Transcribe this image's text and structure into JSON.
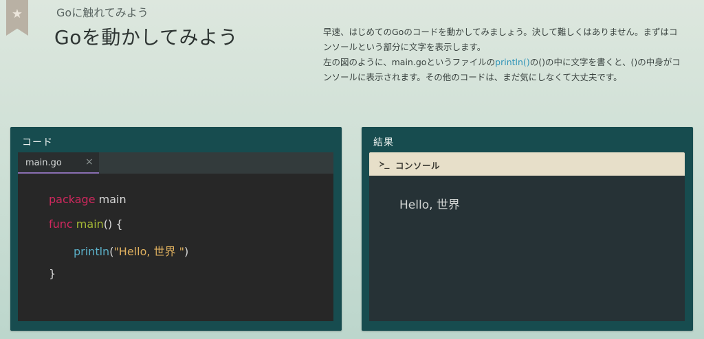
{
  "header": {
    "bookmark_icon": "star-icon",
    "subtitle": "Goに触れてみよう",
    "title": "Goを動かしてみよう"
  },
  "description": {
    "paragraph1": "早速、はじめてのGoのコードを動かしてみましょう。決して難しくはありません。まずはコンソールという部分に文字を表示します。",
    "p2_before": "左の図のように、main.goというファイルの",
    "p2_code": "println()",
    "p2_after": "の()の中に文字を書くと、()の中身がコンソールに表示されます。その他のコードは、まだ気にしなくて大丈夫です。"
  },
  "code_panel": {
    "title": "コード",
    "tab": {
      "label": "main.go",
      "close": "×"
    },
    "code": {
      "line1_keyword": "package",
      "line1_name": " main",
      "line2_keyword": "func",
      "line2_fn": " main",
      "line2_rest": "() {",
      "line3_fn": "println",
      "line3_open": "(",
      "line3_string": "\"Hello, 世界 \"",
      "line3_close": ")",
      "line4": "}"
    }
  },
  "result_panel": {
    "title": "結果",
    "console": {
      "prompt": "≻_",
      "label": "コンソール",
      "output": "Hello, 世界"
    }
  },
  "colors": {
    "panel_bg": "#174c4f",
    "editor_bg": "#272727",
    "console_bg": "#263236",
    "console_header_bg": "#e7dfc9",
    "keyword": "#d1285e",
    "function": "#a5b935",
    "builtin": "#5bb0c8",
    "string": "#e0b15f",
    "tab_underline": "#8a6fb2",
    "inline_code": "#2f94b8"
  }
}
